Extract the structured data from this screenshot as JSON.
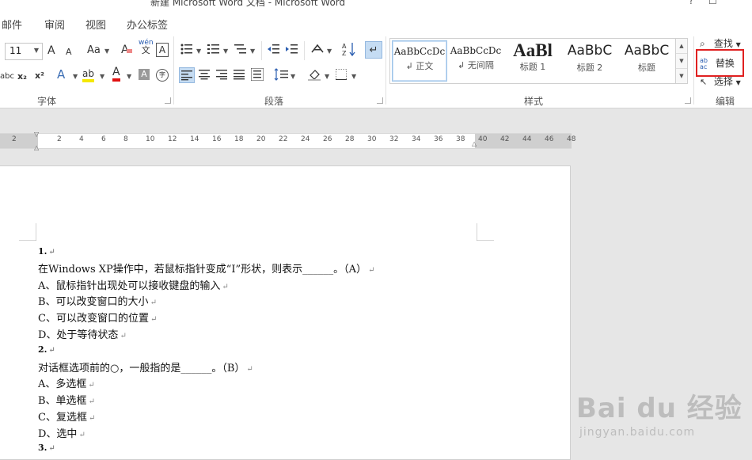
{
  "window": {
    "title": "新建 Microsoft Word 文档 - Microsoft Word",
    "help": "?",
    "restore": "☐"
  },
  "menu": {
    "tabs": [
      "邮件",
      "审阅",
      "视图",
      "办公标签"
    ]
  },
  "ribbon": {
    "font": {
      "size_value": "11",
      "grow_label": "A",
      "shrink_label": "A",
      "case_label": "Aa",
      "phonetic_top": "wén",
      "phonetic_bottom": "文",
      "border_char": "A",
      "strike_label": "abc",
      "sub_label": "x₂",
      "sup_label": "x²",
      "effect_label": "A",
      "highlight_label": "ab",
      "color_label": "A",
      "shade_label": "A",
      "enclose_label": "字",
      "group_label": "字体"
    },
    "paragraph": {
      "group_label": "段落"
    },
    "styles": {
      "items": [
        {
          "sample": "AaBbCcDc",
          "name": "↲ 正文"
        },
        {
          "sample": "AaBbCcDc",
          "name": "↲ 无间隔"
        },
        {
          "sample": "AaBl",
          "name": "标题 1"
        },
        {
          "sample": "AaBbC",
          "name": "标题 2"
        },
        {
          "sample": "AaBbC",
          "name": "标题"
        }
      ],
      "group_label": "样式"
    },
    "editing": {
      "find_label": "查找",
      "replace_label": "替换",
      "select_label": "选择",
      "group_label": "编辑",
      "highlight_color": "#e02020"
    }
  },
  "ruler": {
    "ticks": [
      "2",
      "2",
      "4",
      "6",
      "8",
      "10",
      "12",
      "14",
      "16",
      "18",
      "20",
      "22",
      "24",
      "26",
      "28",
      "30",
      "32",
      "34",
      "36",
      "38",
      "40",
      "42",
      "44",
      "46",
      "48"
    ]
  },
  "document": {
    "paragraphs": [
      "1.",
      "在Windows XP操作中，若鼠标指针变成“I”形状，则表示______。（A）",
      "A、鼠标指针出现处可以接收键盘的输入",
      "B、可以改变窗口的大小",
      "C、可以改变窗口的位置",
      "D、处于等待状态",
      "2.",
      "对话框选项前的○，一般指的是______。（B）",
      "A、多选框",
      "B、单选框",
      "C、复选框",
      "D、选中",
      "3."
    ],
    "para_mark": "↵"
  },
  "watermark": {
    "brand": "Bai du 经验",
    "url": "jingyan.baidu.com"
  }
}
